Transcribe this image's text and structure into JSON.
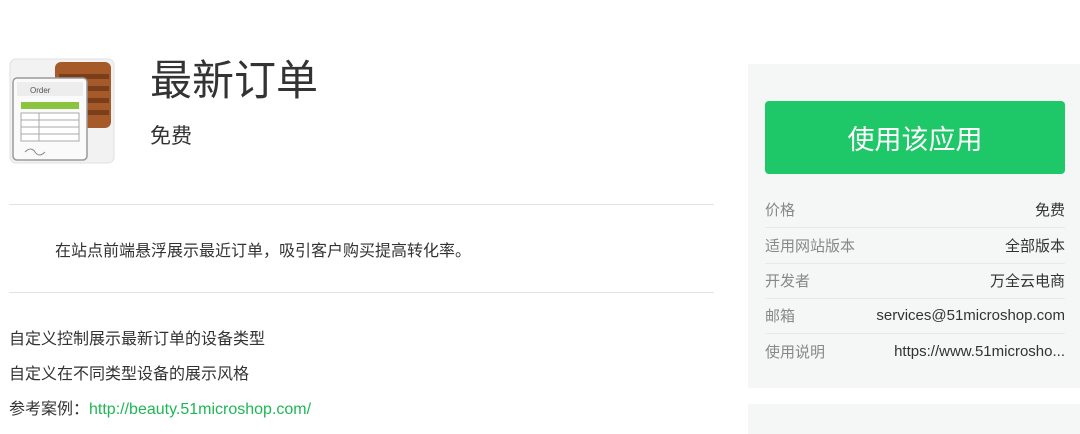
{
  "app": {
    "title": "最新订单",
    "price": "免费",
    "icon": "order-list-icon",
    "icon_label": "Order"
  },
  "description": "在站点前端悬浮展示最近订单，吸引客户购买提高转化率。",
  "features": [
    "自定义控制展示最新订单的设备类型",
    "自定义在不同类型设备的展示风格"
  ],
  "example": {
    "label": "参考案例：",
    "url": "http://beauty.51microshop.com/"
  },
  "sidebar": {
    "use_button": "使用该应用",
    "button_color": "#1ec767",
    "info": [
      {
        "label": "价格",
        "value": "免费"
      },
      {
        "label": "适用网站版本",
        "value": "全部版本"
      },
      {
        "label": "开发者",
        "value": "万全云电商"
      },
      {
        "label": "邮箱",
        "value": "services@51microshop.com"
      },
      {
        "label": "使用说明",
        "value": "https://www.51microsho..."
      }
    ]
  }
}
